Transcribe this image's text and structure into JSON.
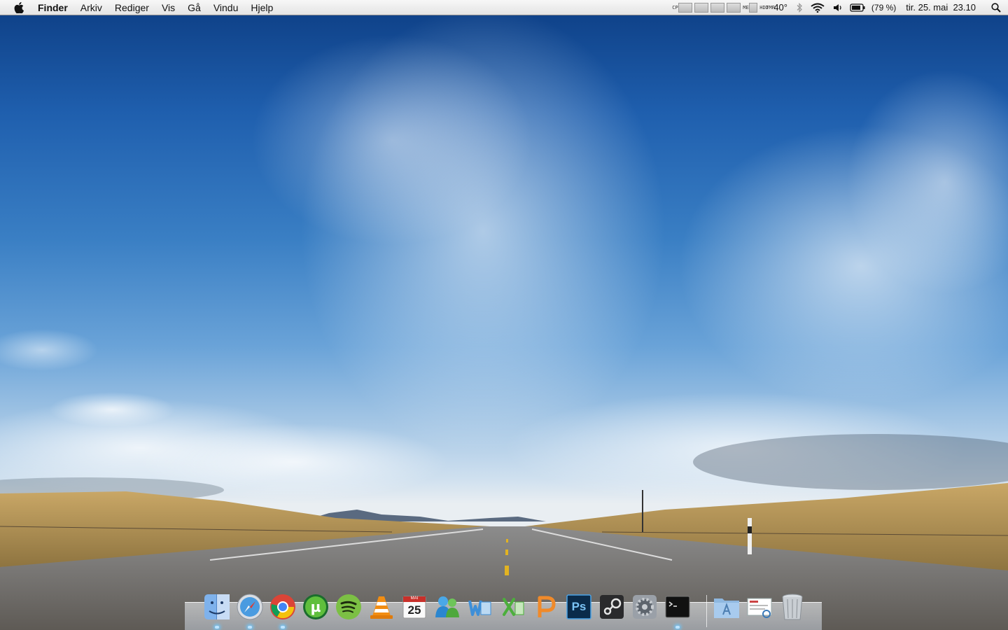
{
  "menubar": {
    "apple_icon": "apple-icon",
    "app_name": "Finder",
    "menus": [
      "Arkiv",
      "Rediger",
      "Vis",
      "Gå",
      "Vindu",
      "Hjelp"
    ],
    "status": {
      "meters": [
        "CPU",
        "MEM",
        "HDD",
        "TMP"
      ],
      "temperature": "40°",
      "battery_percent": "(79 %)",
      "datetime": "tir. 25. mai  23.10"
    }
  },
  "dock": {
    "apps": [
      {
        "name": "Finder",
        "icon": "finder-icon",
        "running": true
      },
      {
        "name": "Safari",
        "icon": "safari-icon",
        "running": true
      },
      {
        "name": "Google Chrome",
        "icon": "chrome-icon",
        "running": true
      },
      {
        "name": "uTorrent",
        "icon": "utorrent-icon",
        "running": false
      },
      {
        "name": "Spotify",
        "icon": "spotify-icon",
        "running": false
      },
      {
        "name": "VLC",
        "icon": "vlc-icon",
        "running": false
      },
      {
        "name": "iCal",
        "icon": "calendar-icon",
        "running": false,
        "badge": "25",
        "month": "MAI"
      },
      {
        "name": "MSN Messenger",
        "icon": "messenger-icon",
        "running": false
      },
      {
        "name": "Word",
        "icon": "word-icon",
        "running": false
      },
      {
        "name": "Excel",
        "icon": "excel-icon",
        "running": false
      },
      {
        "name": "PowerPoint",
        "icon": "powerpoint-icon",
        "running": false
      },
      {
        "name": "Photoshop",
        "icon": "photoshop-icon",
        "running": false,
        "label": "Ps"
      },
      {
        "name": "Steam",
        "icon": "steam-icon",
        "running": false
      },
      {
        "name": "System Preferences",
        "icon": "gear-icon",
        "running": false
      },
      {
        "name": "Terminal",
        "icon": "terminal-icon",
        "running": true
      }
    ],
    "stacks": [
      {
        "name": "Applications",
        "icon": "applications-folder-icon"
      },
      {
        "name": "Preview",
        "icon": "preview-icon"
      },
      {
        "name": "Trash",
        "icon": "trash-icon"
      }
    ]
  }
}
